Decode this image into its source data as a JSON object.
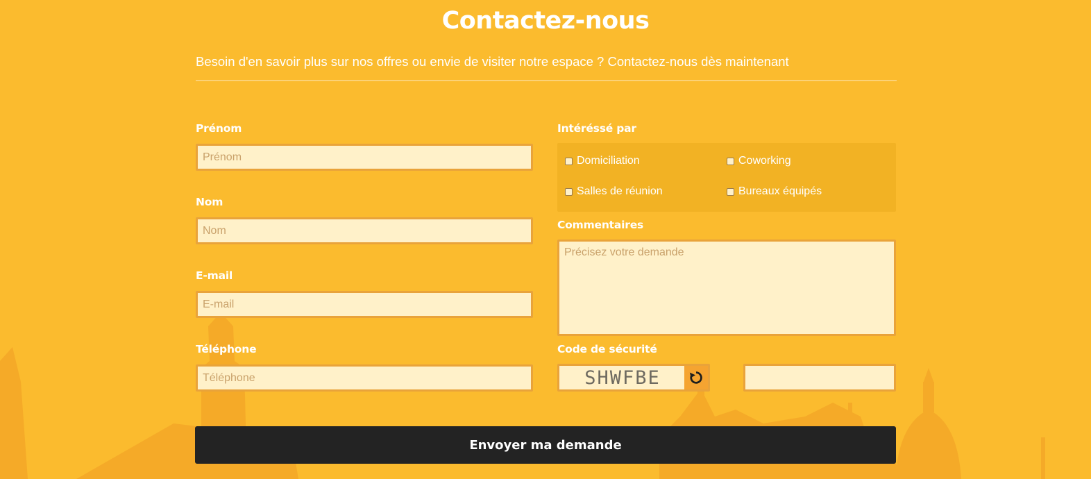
{
  "header": {
    "title": "Contactez-nous",
    "subtitle": "Besoin d'en savoir plus sur nos offres ou envie de visiter notre espace ? Contactez-nous dès maintenant"
  },
  "form": {
    "prenom": {
      "label": "Prénom",
      "placeholder": "Prénom",
      "value": ""
    },
    "nom": {
      "label": "Nom",
      "placeholder": "Nom",
      "value": ""
    },
    "email": {
      "label": "E-mail",
      "placeholder": "E-mail",
      "value": ""
    },
    "telephone": {
      "label": "Téléphone",
      "placeholder": "Téléphone",
      "value": ""
    },
    "interests": {
      "label": "Intéréssé par",
      "options": [
        {
          "label": "Domiciliation",
          "checked": false
        },
        {
          "label": "Coworking",
          "checked": false
        },
        {
          "label": "Salles de réunion",
          "checked": false
        },
        {
          "label": "Bureaux équipés",
          "checked": false
        }
      ]
    },
    "comments": {
      "label": "Commentaires",
      "placeholder": "Précisez votre demande",
      "value": ""
    },
    "security": {
      "label": "Code de sécurité",
      "captcha_text": "SHWFBE",
      "refresh_icon": "refresh-icon",
      "value": ""
    },
    "submit_label": "Envoyer ma demande"
  },
  "colors": {
    "background": "#fbbb2e",
    "field_background": "#fff1c9",
    "field_border": "#e9a33a",
    "button": "#232323",
    "skyline": "#f5a623"
  }
}
